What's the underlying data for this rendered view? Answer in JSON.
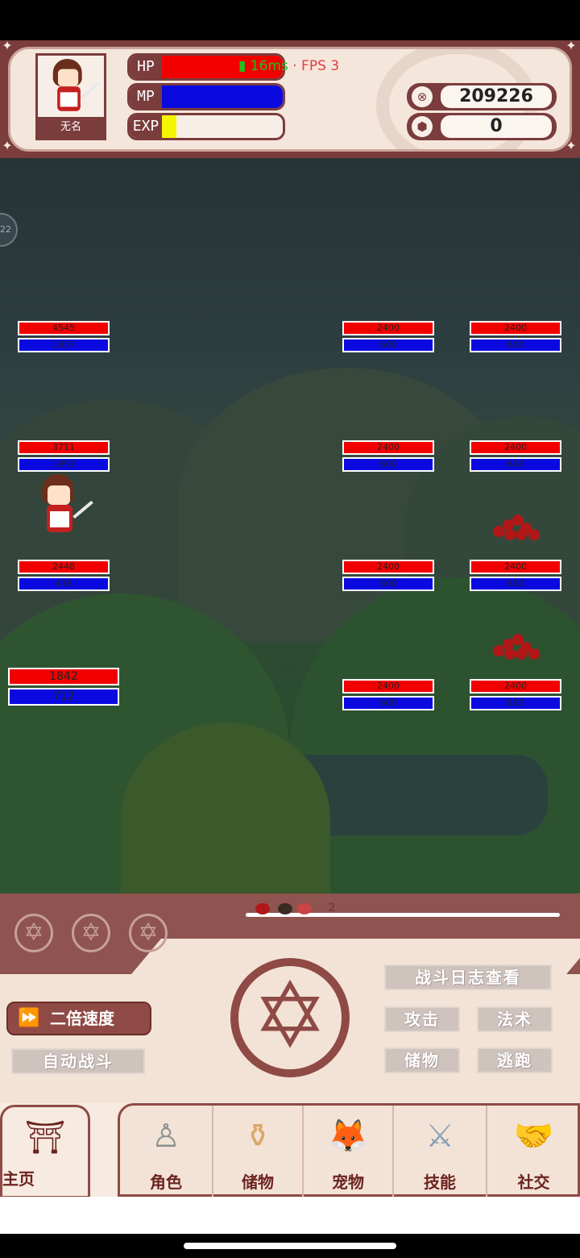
{
  "hud": {
    "player_name": "无名",
    "hp_label": "HP",
    "mp_label": "MP",
    "exp_label": "EXP",
    "hp_fill": 1.0,
    "mp_fill": 1.0,
    "exp_fill": 0.12,
    "net_latency": "16ms",
    "net_sep": "·",
    "fps": "FPS 3",
    "gold": "209226",
    "gems": "0"
  },
  "field": {
    "side_button": "22",
    "allies": [
      {
        "hp": "4545",
        "mp": "1837"
      },
      {
        "hp": "3711",
        "mp": "1851"
      },
      {
        "hp": "2448",
        "mp": "436"
      },
      {
        "hp": "1842",
        "mp": "712"
      }
    ],
    "enemies": [
      {
        "hp": "2400",
        "mp": "600"
      },
      {
        "hp": "2400",
        "mp": "600"
      },
      {
        "hp": "2400",
        "mp": "600"
      },
      {
        "hp": "2400",
        "mp": "600"
      },
      {
        "hp": "2400",
        "mp": "600"
      },
      {
        "hp": "2400",
        "mp": "600"
      },
      {
        "hp": "2400",
        "mp": "600"
      },
      {
        "hp": "2400",
        "mp": "600"
      }
    ]
  },
  "panel": {
    "turn_number": "2",
    "battle_log": "战斗日志查看",
    "attack": "攻击",
    "magic": "法术",
    "items": "储物",
    "flee": "逃跑",
    "speed": "二倍速度",
    "auto_battle": "自动战斗"
  },
  "nav": {
    "home": "主页",
    "character": "角色",
    "storage": "储物",
    "pet": "宠物",
    "skills": "技能",
    "social": "社交"
  },
  "colors": {
    "hp": "#f20000",
    "mp": "#0a0ae0",
    "exp": "#f5f500",
    "theme": "#8f4a46"
  }
}
